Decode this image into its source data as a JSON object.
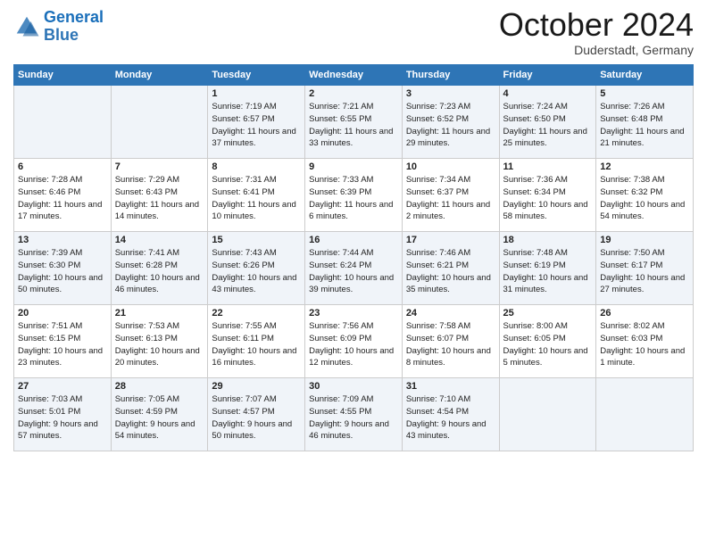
{
  "header": {
    "logo_general": "General",
    "logo_blue": "Blue",
    "month_title": "October 2024",
    "location": "Duderstadt, Germany"
  },
  "days_of_week": [
    "Sunday",
    "Monday",
    "Tuesday",
    "Wednesday",
    "Thursday",
    "Friday",
    "Saturday"
  ],
  "weeks": [
    {
      "days": [
        {
          "date": "",
          "info": ""
        },
        {
          "date": "",
          "info": ""
        },
        {
          "date": "1",
          "sunrise": "Sunrise: 7:19 AM",
          "sunset": "Sunset: 6:57 PM",
          "daylight": "Daylight: 11 hours and 37 minutes."
        },
        {
          "date": "2",
          "sunrise": "Sunrise: 7:21 AM",
          "sunset": "Sunset: 6:55 PM",
          "daylight": "Daylight: 11 hours and 33 minutes."
        },
        {
          "date": "3",
          "sunrise": "Sunrise: 7:23 AM",
          "sunset": "Sunset: 6:52 PM",
          "daylight": "Daylight: 11 hours and 29 minutes."
        },
        {
          "date": "4",
          "sunrise": "Sunrise: 7:24 AM",
          "sunset": "Sunset: 6:50 PM",
          "daylight": "Daylight: 11 hours and 25 minutes."
        },
        {
          "date": "5",
          "sunrise": "Sunrise: 7:26 AM",
          "sunset": "Sunset: 6:48 PM",
          "daylight": "Daylight: 11 hours and 21 minutes."
        }
      ]
    },
    {
      "days": [
        {
          "date": "6",
          "sunrise": "Sunrise: 7:28 AM",
          "sunset": "Sunset: 6:46 PM",
          "daylight": "Daylight: 11 hours and 17 minutes."
        },
        {
          "date": "7",
          "sunrise": "Sunrise: 7:29 AM",
          "sunset": "Sunset: 6:43 PM",
          "daylight": "Daylight: 11 hours and 14 minutes."
        },
        {
          "date": "8",
          "sunrise": "Sunrise: 7:31 AM",
          "sunset": "Sunset: 6:41 PM",
          "daylight": "Daylight: 11 hours and 10 minutes."
        },
        {
          "date": "9",
          "sunrise": "Sunrise: 7:33 AM",
          "sunset": "Sunset: 6:39 PM",
          "daylight": "Daylight: 11 hours and 6 minutes."
        },
        {
          "date": "10",
          "sunrise": "Sunrise: 7:34 AM",
          "sunset": "Sunset: 6:37 PM",
          "daylight": "Daylight: 11 hours and 2 minutes."
        },
        {
          "date": "11",
          "sunrise": "Sunrise: 7:36 AM",
          "sunset": "Sunset: 6:34 PM",
          "daylight": "Daylight: 10 hours and 58 minutes."
        },
        {
          "date": "12",
          "sunrise": "Sunrise: 7:38 AM",
          "sunset": "Sunset: 6:32 PM",
          "daylight": "Daylight: 10 hours and 54 minutes."
        }
      ]
    },
    {
      "days": [
        {
          "date": "13",
          "sunrise": "Sunrise: 7:39 AM",
          "sunset": "Sunset: 6:30 PM",
          "daylight": "Daylight: 10 hours and 50 minutes."
        },
        {
          "date": "14",
          "sunrise": "Sunrise: 7:41 AM",
          "sunset": "Sunset: 6:28 PM",
          "daylight": "Daylight: 10 hours and 46 minutes."
        },
        {
          "date": "15",
          "sunrise": "Sunrise: 7:43 AM",
          "sunset": "Sunset: 6:26 PM",
          "daylight": "Daylight: 10 hours and 43 minutes."
        },
        {
          "date": "16",
          "sunrise": "Sunrise: 7:44 AM",
          "sunset": "Sunset: 6:24 PM",
          "daylight": "Daylight: 10 hours and 39 minutes."
        },
        {
          "date": "17",
          "sunrise": "Sunrise: 7:46 AM",
          "sunset": "Sunset: 6:21 PM",
          "daylight": "Daylight: 10 hours and 35 minutes."
        },
        {
          "date": "18",
          "sunrise": "Sunrise: 7:48 AM",
          "sunset": "Sunset: 6:19 PM",
          "daylight": "Daylight: 10 hours and 31 minutes."
        },
        {
          "date": "19",
          "sunrise": "Sunrise: 7:50 AM",
          "sunset": "Sunset: 6:17 PM",
          "daylight": "Daylight: 10 hours and 27 minutes."
        }
      ]
    },
    {
      "days": [
        {
          "date": "20",
          "sunrise": "Sunrise: 7:51 AM",
          "sunset": "Sunset: 6:15 PM",
          "daylight": "Daylight: 10 hours and 23 minutes."
        },
        {
          "date": "21",
          "sunrise": "Sunrise: 7:53 AM",
          "sunset": "Sunset: 6:13 PM",
          "daylight": "Daylight: 10 hours and 20 minutes."
        },
        {
          "date": "22",
          "sunrise": "Sunrise: 7:55 AM",
          "sunset": "Sunset: 6:11 PM",
          "daylight": "Daylight: 10 hours and 16 minutes."
        },
        {
          "date": "23",
          "sunrise": "Sunrise: 7:56 AM",
          "sunset": "Sunset: 6:09 PM",
          "daylight": "Daylight: 10 hours and 12 minutes."
        },
        {
          "date": "24",
          "sunrise": "Sunrise: 7:58 AM",
          "sunset": "Sunset: 6:07 PM",
          "daylight": "Daylight: 10 hours and 8 minutes."
        },
        {
          "date": "25",
          "sunrise": "Sunrise: 8:00 AM",
          "sunset": "Sunset: 6:05 PM",
          "daylight": "Daylight: 10 hours and 5 minutes."
        },
        {
          "date": "26",
          "sunrise": "Sunrise: 8:02 AM",
          "sunset": "Sunset: 6:03 PM",
          "daylight": "Daylight: 10 hours and 1 minute."
        }
      ]
    },
    {
      "days": [
        {
          "date": "27",
          "sunrise": "Sunrise: 7:03 AM",
          "sunset": "Sunset: 5:01 PM",
          "daylight": "Daylight: 9 hours and 57 minutes."
        },
        {
          "date": "28",
          "sunrise": "Sunrise: 7:05 AM",
          "sunset": "Sunset: 4:59 PM",
          "daylight": "Daylight: 9 hours and 54 minutes."
        },
        {
          "date": "29",
          "sunrise": "Sunrise: 7:07 AM",
          "sunset": "Sunset: 4:57 PM",
          "daylight": "Daylight: 9 hours and 50 minutes."
        },
        {
          "date": "30",
          "sunrise": "Sunrise: 7:09 AM",
          "sunset": "Sunset: 4:55 PM",
          "daylight": "Daylight: 9 hours and 46 minutes."
        },
        {
          "date": "31",
          "sunrise": "Sunrise: 7:10 AM",
          "sunset": "Sunset: 4:54 PM",
          "daylight": "Daylight: 9 hours and 43 minutes."
        },
        {
          "date": "",
          "info": ""
        },
        {
          "date": "",
          "info": ""
        }
      ]
    }
  ]
}
